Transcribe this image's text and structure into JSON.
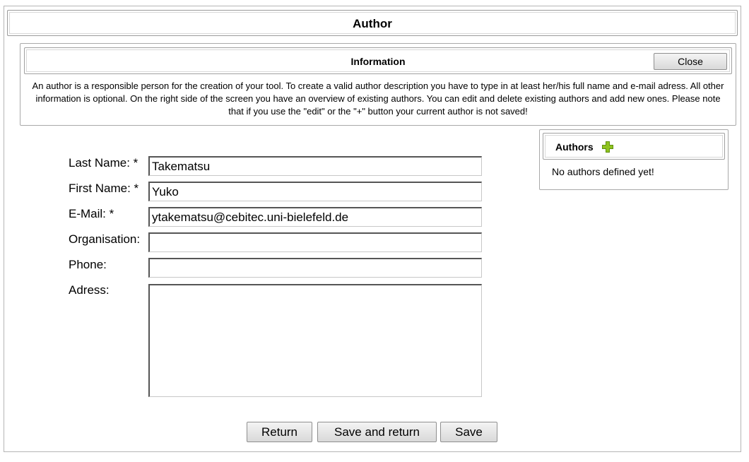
{
  "window": {
    "title": "Author"
  },
  "information": {
    "title": "Information",
    "close_label": "Close",
    "text": "An author is a responsible person for the creation of your tool. To create a valid author description you have to type in at least her/his full name and e-mail adress. All other information is optional. On the right side of the screen you have an overview of existing authors. You can edit and delete existing authors and add new ones. Please note that if you use the \"edit\" or the \"+\" button your current author is not saved!"
  },
  "authors_panel": {
    "title": "Authors",
    "add_icon": "plus-icon",
    "add_icon_color": "#8fc31f",
    "empty_text": "No authors defined yet!"
  },
  "form": {
    "last_name": {
      "label": "Last Name: *",
      "value": "Takematsu"
    },
    "first_name": {
      "label": "First Name: *",
      "value": "Yuko"
    },
    "email": {
      "label": "E-Mail: *",
      "value": "ytakematsu@cebitec.uni-bielefeld.de"
    },
    "organisation": {
      "label": "Organisation:",
      "value": ""
    },
    "phone": {
      "label": "Phone:",
      "value": ""
    },
    "address": {
      "label": "Adress:",
      "value": ""
    }
  },
  "buttons": {
    "return_label": "Return",
    "save_return_label": "Save and return",
    "save_label": "Save"
  }
}
